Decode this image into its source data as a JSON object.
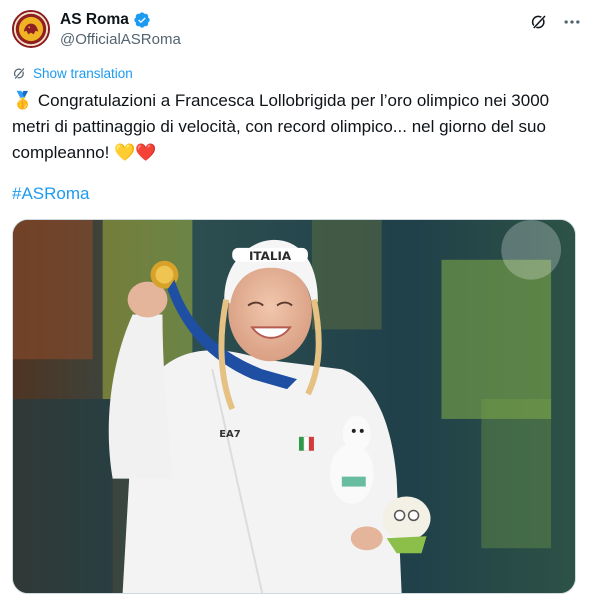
{
  "tweet": {
    "author": {
      "display_name": "AS Roma",
      "handle": "@OfficialASRoma",
      "verified": true,
      "avatar_icon": "as-roma-wolf-crest-icon",
      "verified_color": "#1d9bf0"
    },
    "actions": {
      "grok_icon": "grok-icon",
      "more_icon": "more-dots-icon"
    },
    "translation_label": "Show translation",
    "text": "🥇 Congratulazioni a Francesca Lollobrigida per l’oro olimpico nei 3000 metri di pattinaggio di velocità, con record olimpico... nel giorno del suo compleanno! 💛❤️",
    "hashtag": "#ASRoma",
    "media": {
      "caption_text_on_beanie": "ITALIA",
      "jacket_logo": "EA7"
    }
  },
  "colors": {
    "link": "#1d9bf0",
    "text": "#0f1419",
    "muted": "#536471",
    "border": "#cfd9de"
  }
}
